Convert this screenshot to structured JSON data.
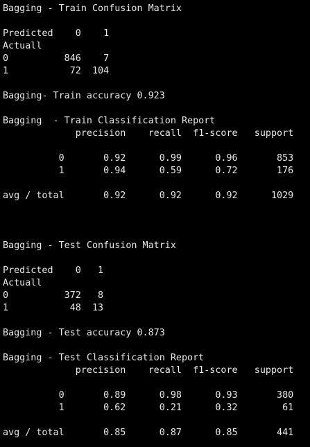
{
  "terminal": {
    "lines": [
      "Bagging - Train Confusion Matrix",
      "Predicted    0    1",
      "Actuall",
      "0          846    7",
      "1           72  104",
      "Bagging- Train accuracy 0.923",
      "Bagging  - Train Classification Report",
      "             precision    recall  f1-score   support",
      "          0       0.92      0.99      0.96       853",
      "          1       0.94      0.59      0.72       176",
      "avg / total       0.92      0.92      0.92      1029",
      "Bagging - Test Confusion Matrix",
      "Predicted    0   1",
      "Actuall",
      "0          372   8",
      "1           48  13",
      "Bagging - Test accuracy 0.873",
      "Bagging - Test Classification Report",
      "             precision    recall  f1-score   support",
      "          0       0.89      0.98      0.93       380",
      "          1       0.62      0.21      0.32        61",
      "avg / total       0.85      0.87      0.85       441"
    ],
    "text_color": "#e8e8e8",
    "background_color": "#000000"
  }
}
